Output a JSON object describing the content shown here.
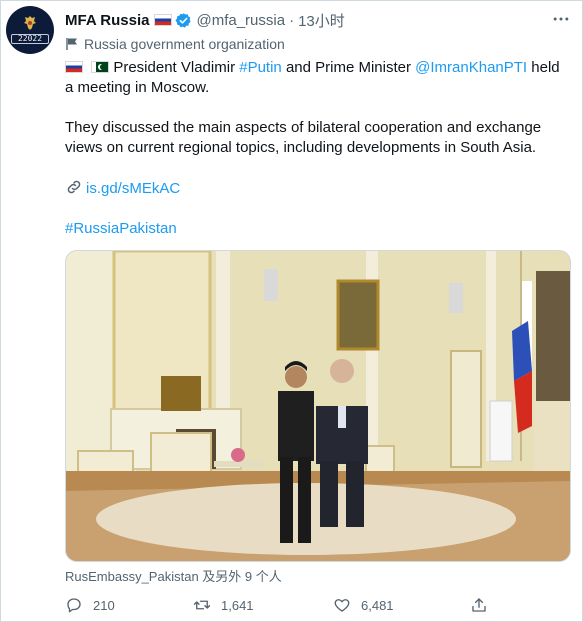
{
  "tweet": {
    "display_name": "MFA Russia",
    "handle": "@mfa_russia",
    "separator": "·",
    "time": "13小时",
    "more_icon": "more-horizontal-icon",
    "verified_icon": "verified-badge-icon",
    "label": "Russia government organization",
    "avatar_text": "22022",
    "body": {
      "p1_a": "President Vladimir ",
      "p1_hashtag_putin": "#Putin",
      "p1_b": " and Prime Minister ",
      "p1_mention": "@ImranKhanPTI",
      "p1_c": " held a meeting in Moscow.",
      "p2": "They discussed the main aspects of bilateral cooperation and exchange views on current regional topics, including developments in South Asia.",
      "link": "is.gd/sMEkAC",
      "hashtag": "#RussiaPakistan"
    },
    "media_caption": "RusEmbassy_Pakistan 及另外 9 个人",
    "actions": {
      "replies": "210",
      "retweets": "1,641",
      "likes": "6,481"
    }
  },
  "colors": {
    "link": "#1d9bf0",
    "text": "#0f1419",
    "muted": "#536471",
    "border": "#cfd9de"
  }
}
